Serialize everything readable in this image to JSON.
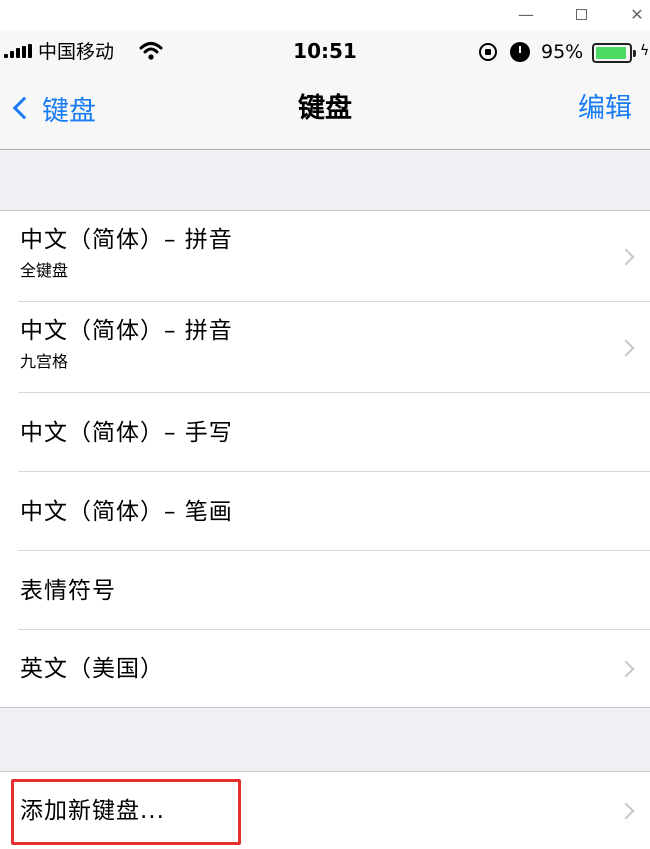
{
  "window_controls": {
    "minimize": "—",
    "close": "✕"
  },
  "status_bar": {
    "carrier": "中国移动",
    "time": "10:51",
    "battery_percent": "95%",
    "battery_level": 0.95,
    "icons": [
      "signal-bars-icon",
      "wifi-icon",
      "orientation-lock-icon",
      "alarm-icon",
      "battery-icon",
      "charging-icon"
    ],
    "battery_color": "#4cd964"
  },
  "nav": {
    "back_label": "键盘",
    "title": "键盘",
    "edit_label": "编辑",
    "accent_color": "#1a7cf5"
  },
  "keyboards": [
    {
      "title": "中文（简体）– 拼音",
      "subtitle": "全键盘"
    },
    {
      "title": "中文（简体）– 拼音",
      "subtitle": "九宫格"
    },
    {
      "title": "中文（简体）– 手写"
    },
    {
      "title": "中文（简体）– 笔画"
    },
    {
      "title": "表情符号"
    },
    {
      "title": "英文（美国）"
    }
  ],
  "add_keyboard": {
    "label": "添加新键盘..."
  },
  "highlight_color": "#e53030"
}
